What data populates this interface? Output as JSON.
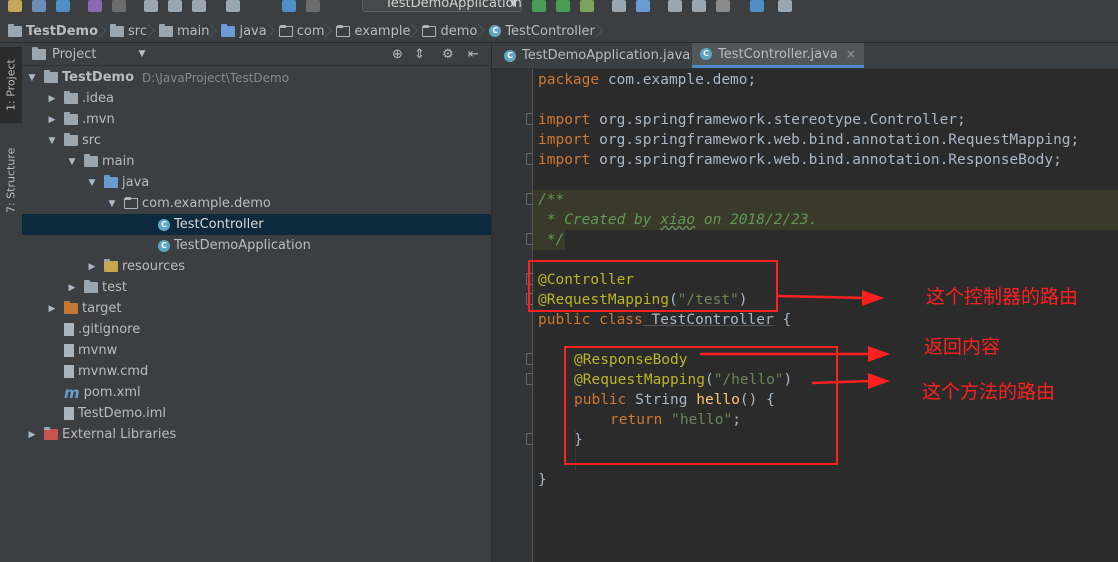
{
  "toolbar": {
    "run_config": "TestDemoApplication"
  },
  "breadcrumb": [
    {
      "label": "TestDemo",
      "bold": true
    },
    {
      "label": "src"
    },
    {
      "label": "main"
    },
    {
      "label": "java"
    },
    {
      "label": "com"
    },
    {
      "label": "example"
    },
    {
      "label": "demo"
    },
    {
      "label": "TestController"
    }
  ],
  "sidebar_tabs": {
    "project": "1: Project",
    "structure": "7: Structure"
  },
  "project_panel": {
    "title": "Project"
  },
  "tree": [
    {
      "label": "TestDemo",
      "path": "D:\\JavaProject\\TestDemo",
      "indent": 0,
      "arrow": "down",
      "icon": "folder"
    },
    {
      "label": ".idea",
      "indent": 1,
      "arrow": "right",
      "icon": "folder"
    },
    {
      "label": ".mvn",
      "indent": 1,
      "arrow": "right",
      "icon": "folder"
    },
    {
      "label": "src",
      "indent": 1,
      "arrow": "down",
      "icon": "folder"
    },
    {
      "label": "main",
      "indent": 2,
      "arrow": "down",
      "icon": "folder"
    },
    {
      "label": "java",
      "indent": 3,
      "arrow": "down",
      "icon": "folder-blue"
    },
    {
      "label": "com.example.demo",
      "indent": 4,
      "arrow": "down",
      "icon": "folder-hollow"
    },
    {
      "label": "TestController",
      "indent": 5,
      "arrow": "",
      "icon": "class",
      "selected": true
    },
    {
      "label": "TestDemoApplication",
      "indent": 5,
      "arrow": "",
      "icon": "class"
    },
    {
      "label": "resources",
      "indent": 3,
      "arrow": "right",
      "icon": "folder-res"
    },
    {
      "label": "test",
      "indent": 2,
      "arrow": "right",
      "icon": "folder"
    },
    {
      "label": "target",
      "indent": 1,
      "arrow": "right",
      "icon": "folder-orange"
    },
    {
      "label": ".gitignore",
      "indent": 1,
      "arrow": "",
      "icon": "file"
    },
    {
      "label": "mvnw",
      "indent": 1,
      "arrow": "",
      "icon": "file"
    },
    {
      "label": "mvnw.cmd",
      "indent": 1,
      "arrow": "",
      "icon": "file"
    },
    {
      "label": "pom.xml",
      "indent": 1,
      "arrow": "",
      "icon": "maven"
    },
    {
      "label": "TestDemo.iml",
      "indent": 1,
      "arrow": "",
      "icon": "file"
    },
    {
      "label": "External Libraries",
      "indent": 0,
      "arrow": "right",
      "icon": "libraries"
    }
  ],
  "editor_tabs": [
    {
      "label": "TestDemoApplication.java",
      "close": "×",
      "active": false
    },
    {
      "label": "TestController.java",
      "close": "×",
      "active": true
    }
  ],
  "code": {
    "l1_kw": "package",
    "l1_rest": " com.example.demo;",
    "l3_kw": "import",
    "l3_rest": " org.springframework.stereotype.Controller;",
    "l4_kw": "import",
    "l4_rest": " org.springframework.web.bind.annotation.RequestMapping;",
    "l5_kw": "import",
    "l5_rest": " org.springframework.web.bind.annotation.ResponseBody;",
    "c1": "/**",
    "c2a": " * Created by ",
    "c2b": "xiao",
    "c2c": " on 2018/2/23.",
    "c3": " */",
    "a1": "@Controller",
    "a2": "@RequestMapping",
    "a2p1": "(",
    "a2s": "\"/test\"",
    "a2p2": ")",
    "cls_kw": "public class",
    "cls_name": " TestController",
    "cls_brace": " {",
    "m1": "@ResponseBody",
    "m2": "@RequestMapping",
    "m2p1": "(",
    "m2s": "\"/hello\"",
    "m2p2": ")",
    "m3_kw": "public",
    "m3_type": " String ",
    "m3_fn": "hello",
    "m3_rest": "() {",
    "m4_kw": "return",
    "m4_str": " \"hello\"",
    "m4_semi": ";",
    "m5": "}",
    "end": "}"
  },
  "annotations": {
    "route_controller": "这个控制器的路由",
    "return_content": "返回内容",
    "route_method": "这个方法的路由"
  },
  "colors": {
    "annotation_red": "#ff2020",
    "keyword": "#cc7832",
    "string": "#6a8759",
    "comment": "#629755"
  }
}
